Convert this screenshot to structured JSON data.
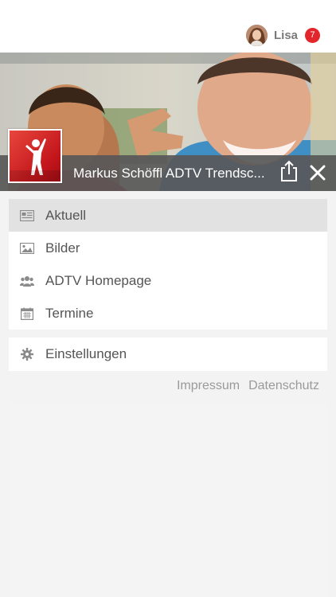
{
  "header": {
    "user_name": "Lisa",
    "notification_count": "7"
  },
  "page": {
    "title": "Markus Schöffl ADTV Trendsc..."
  },
  "menu": {
    "items": [
      {
        "label": "Aktuell",
        "icon": "newspaper-icon",
        "active": true
      },
      {
        "label": "Bilder",
        "icon": "image-icon",
        "active": false
      },
      {
        "label": "ADTV Homepage",
        "icon": "users-icon",
        "active": false
      },
      {
        "label": "Termine",
        "icon": "calendar-icon",
        "active": false
      }
    ],
    "settings_label": "Einstellungen"
  },
  "footer": {
    "impressum": "Impressum",
    "datenschutz": "Datenschutz"
  },
  "colors": {
    "badge": "#e3262c",
    "title_bar": "#585858",
    "logo_red": "#c3161c"
  }
}
